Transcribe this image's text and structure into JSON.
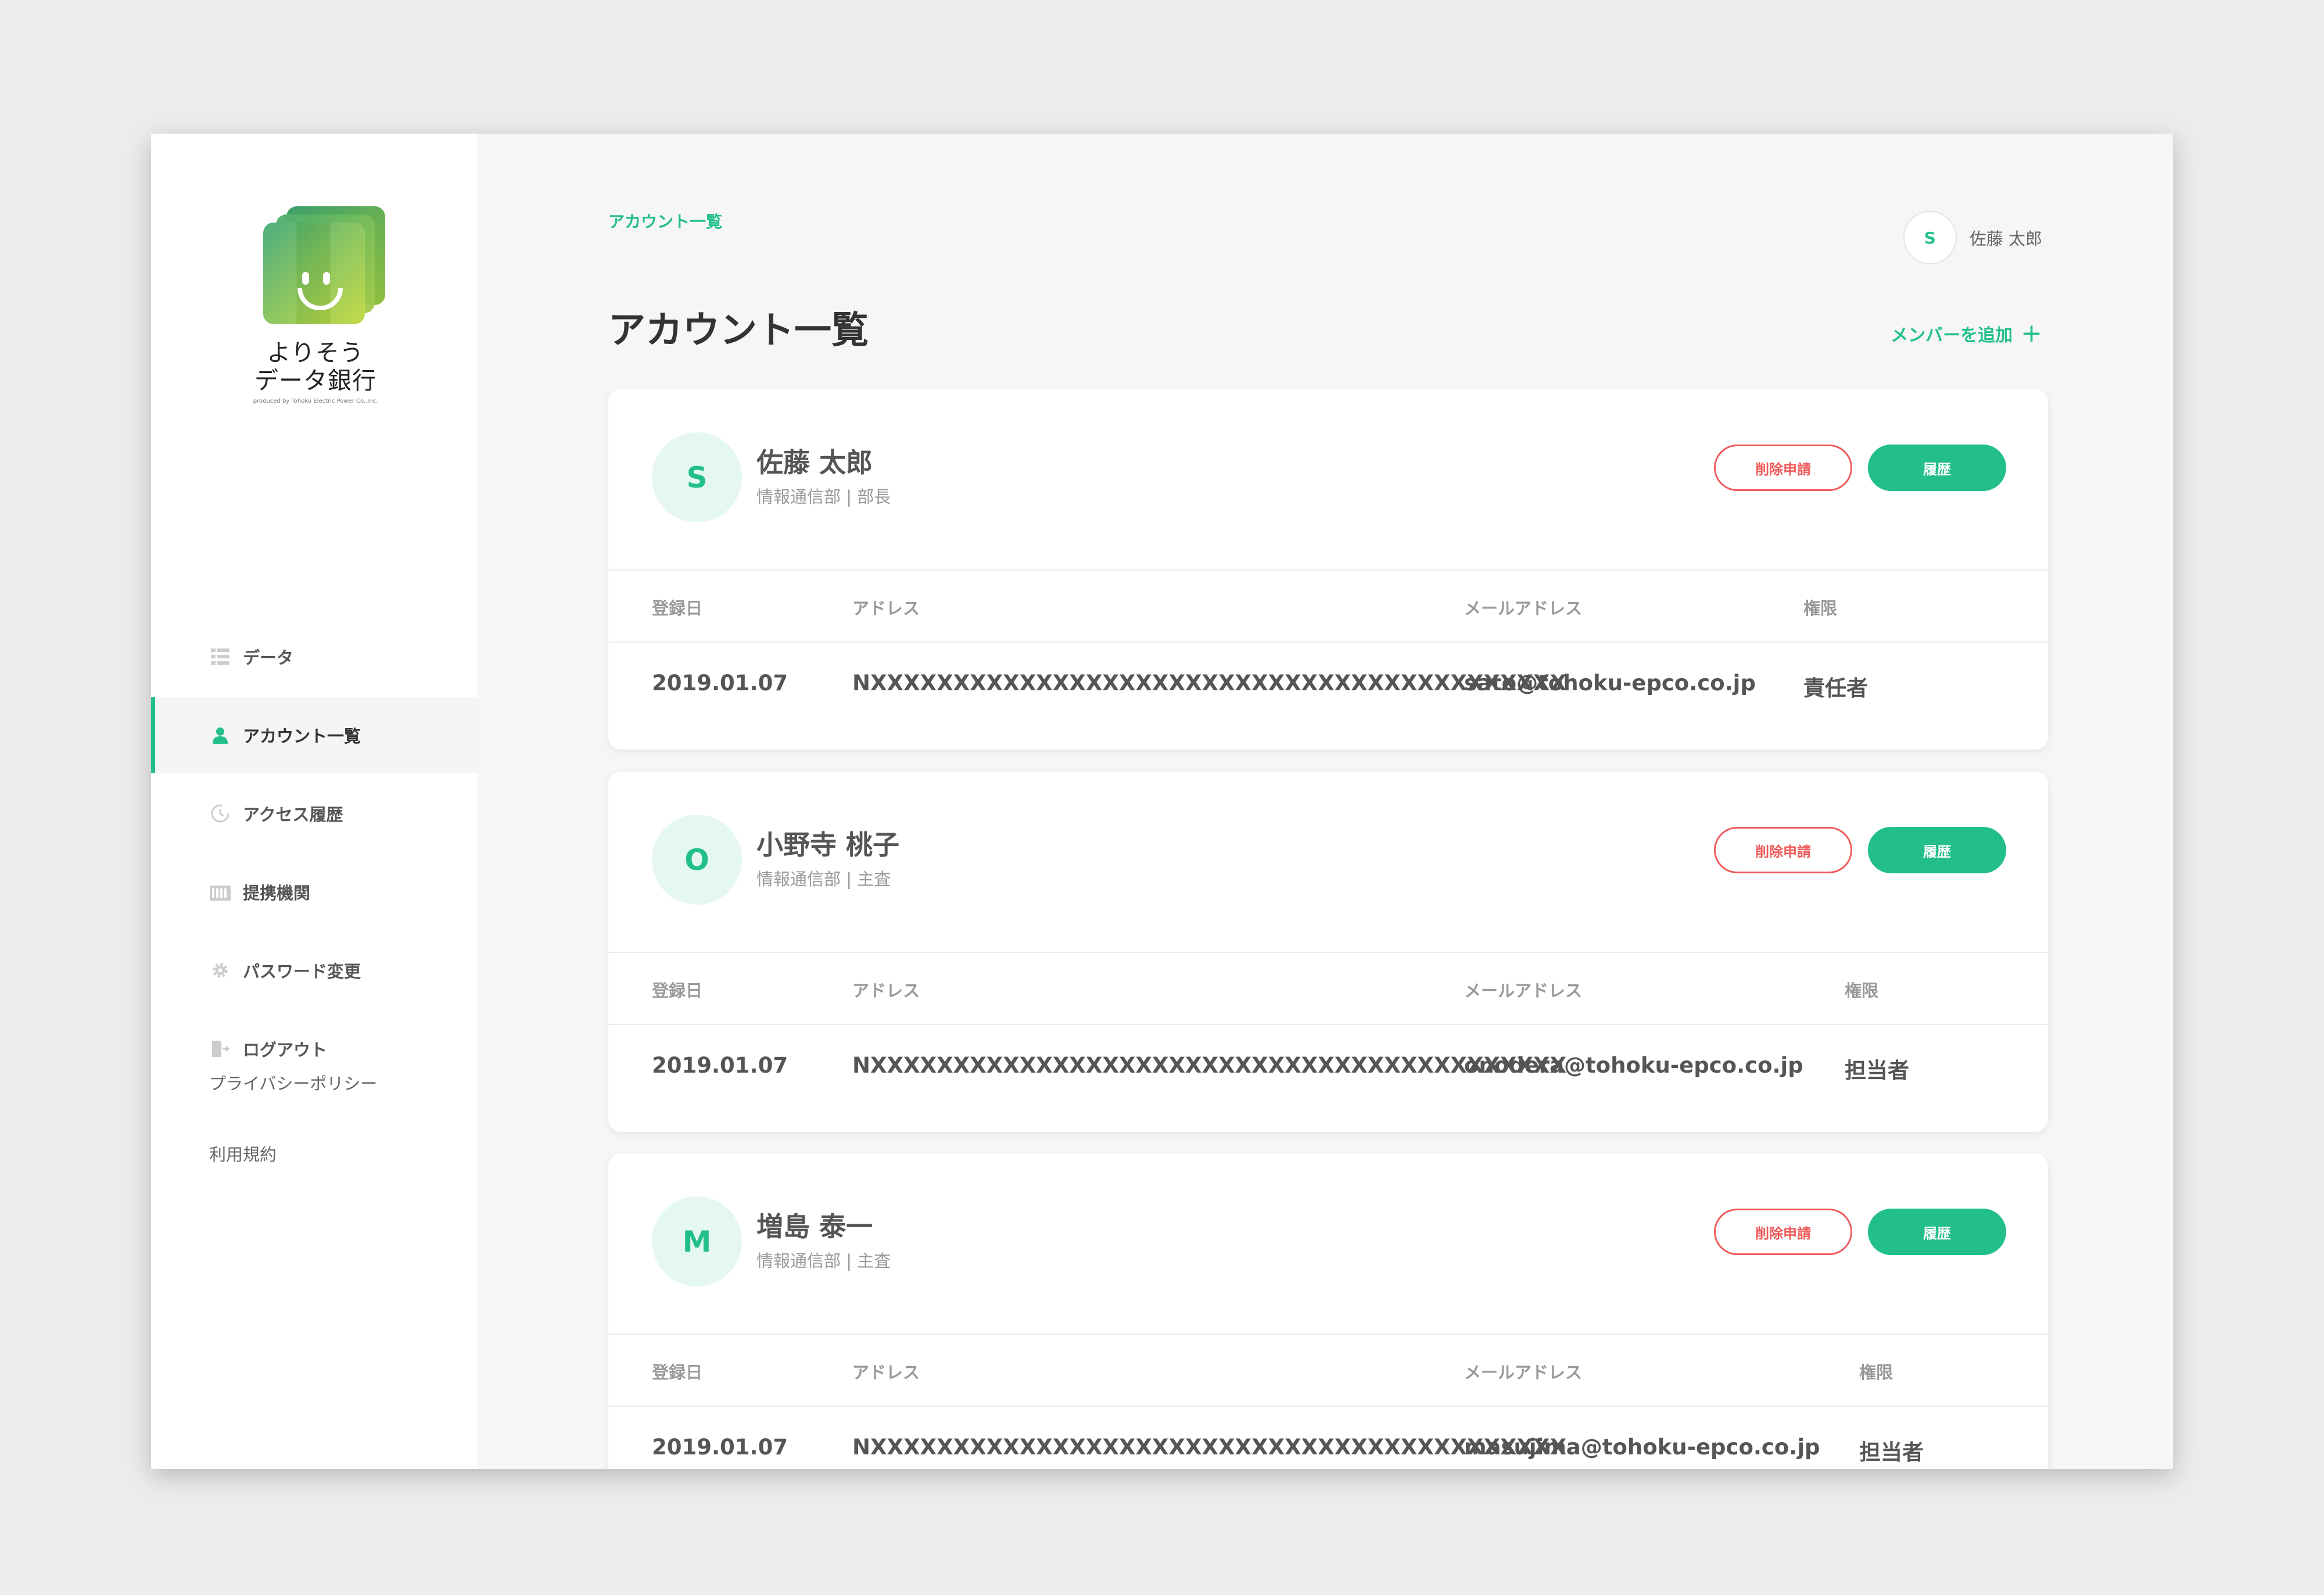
{
  "brand": {
    "name_line1": "よりそう",
    "name_line2": "データ銀行",
    "tagline": "produced by Tohoku Electric Power Co.,Inc."
  },
  "sidebar": {
    "items": [
      {
        "label": "データ",
        "icon": "data-grid-icon",
        "active": false
      },
      {
        "label": "アカウント一覧",
        "icon": "person-icon",
        "active": true
      },
      {
        "label": "アクセス履歴",
        "icon": "history-clock-icon",
        "active": false
      },
      {
        "label": "提携機関",
        "icon": "building-icon",
        "active": false
      },
      {
        "label": "パスワード変更",
        "icon": "gear-icon",
        "active": false
      },
      {
        "label": "ログアウト",
        "icon": "logout-door-icon",
        "active": false
      }
    ],
    "footer": {
      "privacy": "プライバシーポリシー",
      "terms": "利用規約"
    }
  },
  "header": {
    "breadcrumb": "アカウント一覧",
    "user_initial": "S",
    "user_name": "佐藤 太郎",
    "title": "アカウント一覧",
    "add_member": "メンバーを追加"
  },
  "columns": {
    "date": "登録日",
    "address": "アドレス",
    "email": "メールアドレス",
    "role": "権限"
  },
  "buttons": {
    "delete": "削除申請",
    "history": "履歴"
  },
  "accounts": [
    {
      "initial": "S",
      "name": "佐藤 太郎",
      "dept": "情報通信部 | 部長",
      "date": "2019.01.07",
      "address": "NXXXXXXXXXXXXXXXXXXXXXXXXXXXXXXXXXXXXXXXXXX",
      "email": "sato@tohoku-epco.co.jp",
      "role": "責任者"
    },
    {
      "initial": "O",
      "name": "小野寺 桃子",
      "dept": "情報通信部 | 主査",
      "date": "2019.01.07",
      "address": "NXXXXXXXXXXXXXXXXXXXXXXXXXXXXXXXXXXXXXXXXXX",
      "email": "onodera@tohoku-epco.co.jp",
      "role": "担当者"
    },
    {
      "initial": "M",
      "name": "増島 泰一",
      "dept": "情報通信部 | 主査",
      "date": "2019.01.07",
      "address": "NXXXXXXXXXXXXXXXXXXXXXXXXXXXXXXXXXXXXXXXXXX",
      "email": "masujima@tohoku-epco.co.jp",
      "role": "担当者"
    }
  ],
  "colors": {
    "accent": "#22bf8a",
    "danger": "#ef5a5a",
    "avatar_bg": "#e5f7f1"
  }
}
